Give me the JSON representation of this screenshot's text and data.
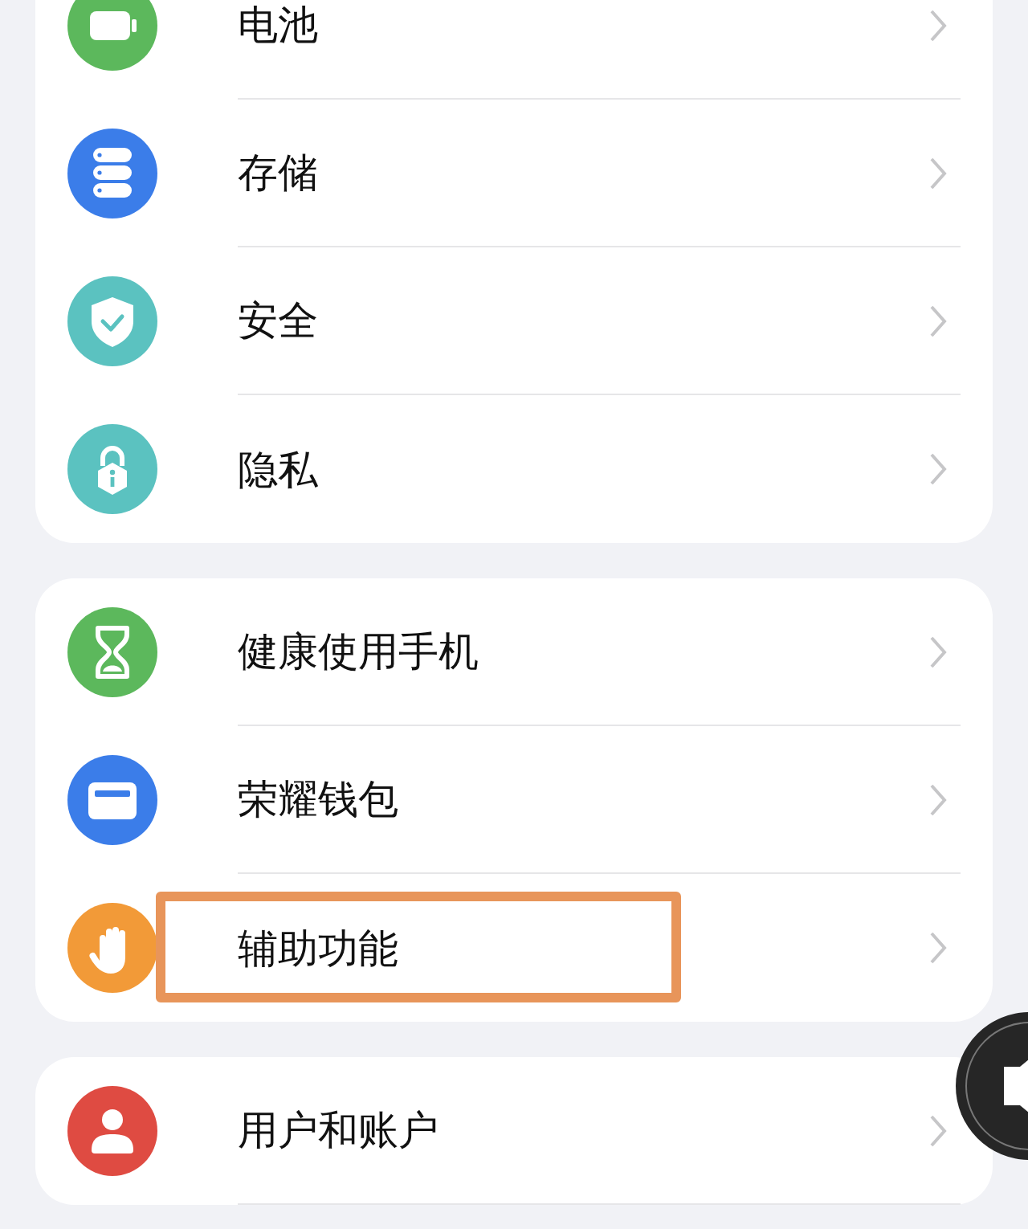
{
  "groups": [
    {
      "items": [
        {
          "kind": "battery",
          "color": "#5cb85c",
          "label": "电池",
          "highlighted": false
        },
        {
          "kind": "storage",
          "color": "#3b7de9",
          "label": "存储",
          "highlighted": false
        },
        {
          "kind": "shield",
          "color": "#5bc2c0",
          "label": "安全",
          "highlighted": false
        },
        {
          "kind": "lock",
          "color": "#5bc2c0",
          "label": "隐私",
          "highlighted": false
        }
      ]
    },
    {
      "items": [
        {
          "kind": "hourglass",
          "color": "#5cb85c",
          "label": "健康使用手机",
          "highlighted": false
        },
        {
          "kind": "wallet",
          "color": "#3b7de9",
          "label": "荣耀钱包",
          "highlighted": false
        },
        {
          "kind": "hand",
          "color": "#f29a38",
          "label": "辅助功能",
          "highlighted": true
        }
      ]
    },
    {
      "items": [
        {
          "kind": "person",
          "color": "#df4b42",
          "label": "用户和账户",
          "highlighted": false
        }
      ]
    }
  ]
}
